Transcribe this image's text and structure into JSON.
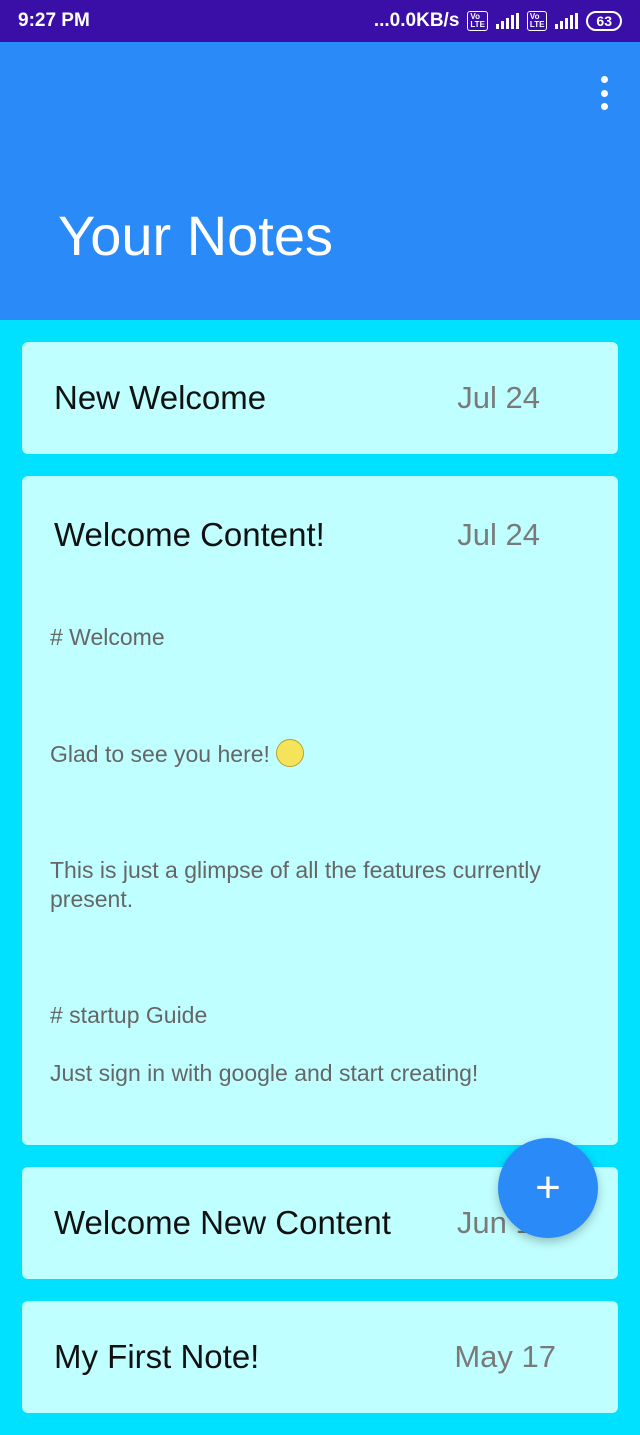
{
  "status": {
    "time": "9:27 PM",
    "network_speed": "...0.0KB/s",
    "battery": "63"
  },
  "header": {
    "title": "Your Notes",
    "menu_icon": "more-vert-icon"
  },
  "notes": [
    {
      "title": "New Welcome",
      "date": "Jul 24"
    },
    {
      "title": "Welcome Content!",
      "date": "Jul 24",
      "lines": [
        "# Welcome",
        "",
        "Glad to see you here!",
        "",
        "This is just a glimpse of all the features currently present.",
        "",
        "# startup Guide",
        "Just sign in with google and start creating!"
      ]
    },
    {
      "title": "Welcome New Content",
      "date": "Jun 18"
    },
    {
      "title": "My First Note!",
      "date": "May 17"
    }
  ],
  "fab": {
    "label": "+",
    "icon": "add-icon"
  },
  "colors": {
    "statusbar": "#3a0fa8",
    "header": "#2a8af7",
    "background": "#00e0ff",
    "card": "#c0ffff"
  }
}
